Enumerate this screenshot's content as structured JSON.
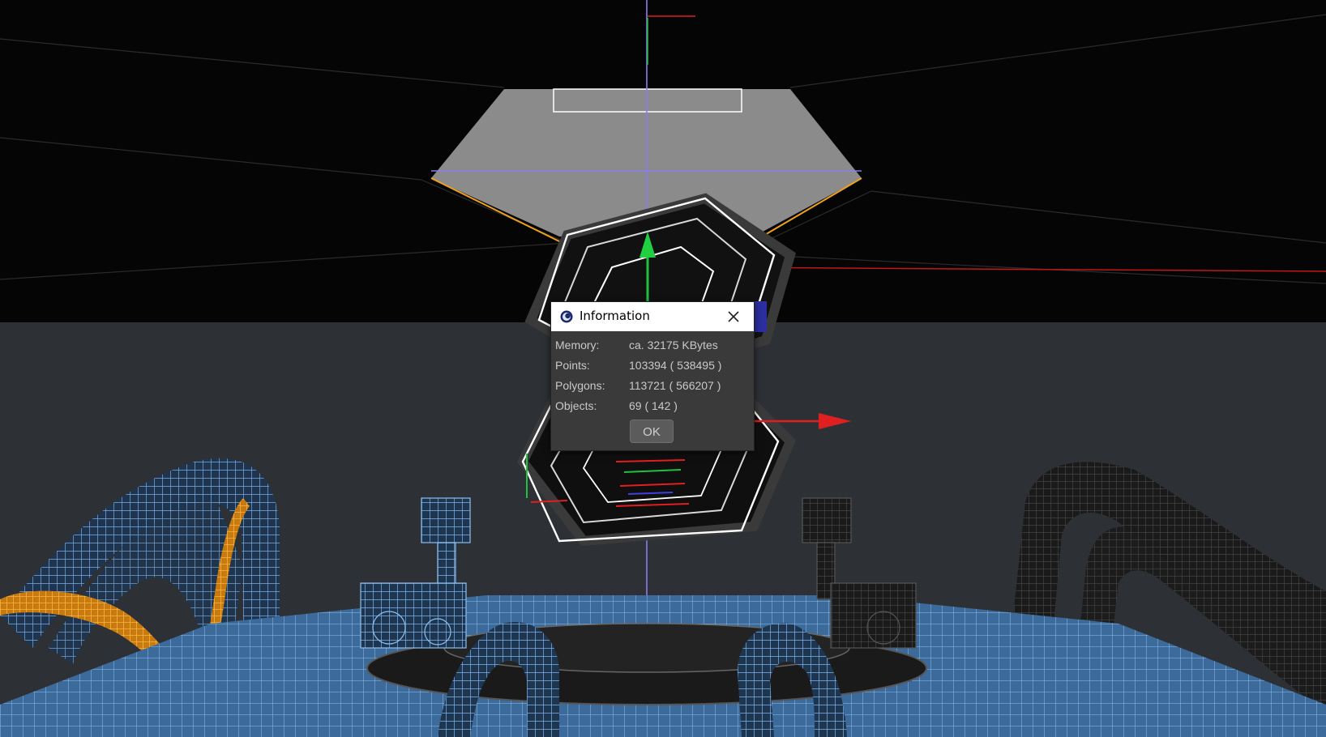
{
  "dialog": {
    "title": "Information",
    "icon": "cinema4d-app-icon",
    "close_icon": "close-icon",
    "rows": [
      {
        "label": "Memory:",
        "value": "ca. 32175 KBytes"
      },
      {
        "label": "Points:",
        "value": "103394 ( 538495 )"
      },
      {
        "label": "Polygons:",
        "value": "113721 ( 566207 )"
      },
      {
        "label": "Objects:",
        "value": "69 ( 142 )"
      }
    ],
    "ok_label": "OK"
  },
  "colors": {
    "viewport_sky": "#050505",
    "viewport_ground": "#2c2f34",
    "wireframe_blue": "#6fa6e0",
    "selected_orange": "#f0a020",
    "axis_x": "#e02020",
    "axis_y": "#20c040",
    "axis_z": "#3040d0",
    "dialog_bg": "#3a3a3a"
  }
}
